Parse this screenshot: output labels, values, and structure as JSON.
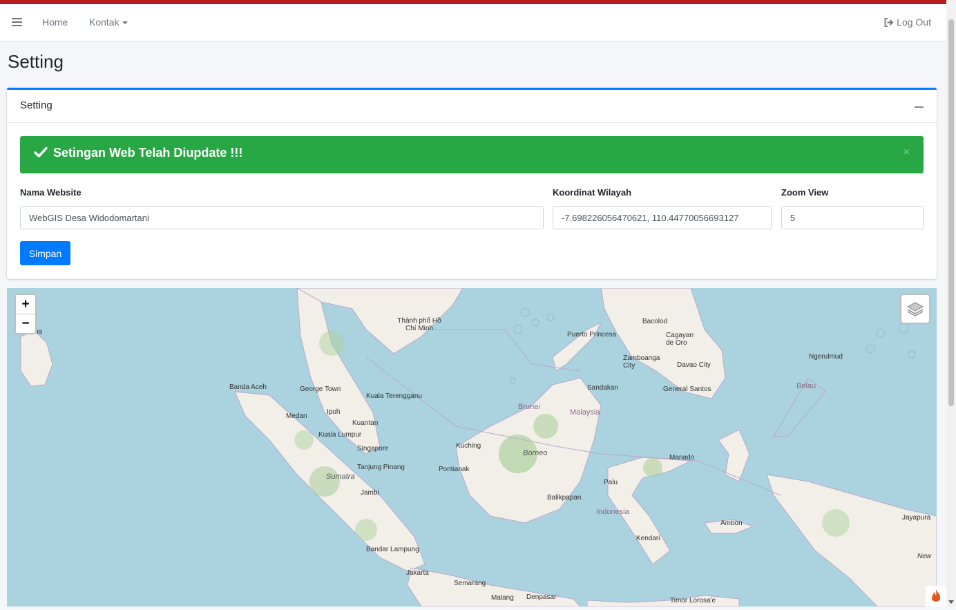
{
  "navbar": {
    "home": "Home",
    "kontak": "Kontak",
    "logout": "Log Out"
  },
  "page": {
    "title": "Setting"
  },
  "card": {
    "title": "Setting",
    "alert": {
      "message": "Setingan Web Telah Diupdate !!!",
      "close": "×"
    },
    "form": {
      "nama_website_label": "Nama Website",
      "nama_website_value": "WebGIS Desa Widodomartani",
      "koordinat_label": "Koordinat Wilayah",
      "koordinat_value": "-7.698226056470621, 110.44770056693127",
      "zoom_label": "Zoom View",
      "zoom_value": "5",
      "submit": "Simpan"
    }
  },
  "map": {
    "zoom_in": "+",
    "zoom_out": "−",
    "labels": {
      "banda_aceh": "Banda Aceh",
      "george_town": "George Town",
      "kuala_terengganu": "Kuala Terengganu",
      "medan": "Medan",
      "ipoh": "Ipoh",
      "kuantan": "Kuantan",
      "kuala_lumpur": "Kuala Lumpur",
      "singapore": "Singapore",
      "tanjung_pinang": "Tanjung Pinang",
      "sumatra": "Sumatra",
      "jambi": "Jambi",
      "bandar_lampung": "Bandar Lampung",
      "jakarta": "Jakarta",
      "semarang": "Semarang",
      "malang": "Malang",
      "denpasar": "Denpasar",
      "kuching": "Kuching",
      "pontianak": "Pontianak",
      "borneo": "Borneo",
      "brunei": "Brunei",
      "malaysia": "Malaysia",
      "sandakan": "Sandakan",
      "balikpapan": "Balikpapan",
      "palu": "Palu",
      "indonesia": "Indonesia",
      "kendari": "Kendari",
      "manado": "Manado",
      "ambon": "Ambon",
      "jayapura": "Jayapura",
      "puerto_princesa": "Puerto Princesa",
      "bacolod": "Bacolod",
      "cagayan": "Cagayan de Oro",
      "zamboanga": "Zamboanga City",
      "davao": "Davao City",
      "general_santos": "General Santos",
      "ngerulmud": "Ngerulmud",
      "belau": "Belau",
      "ho_chi_minh": "Thành phố Hồ Chí Minh",
      "jaffna": "Jaffna",
      "timor": "Timor Lorosa'e",
      "new": "New"
    }
  }
}
